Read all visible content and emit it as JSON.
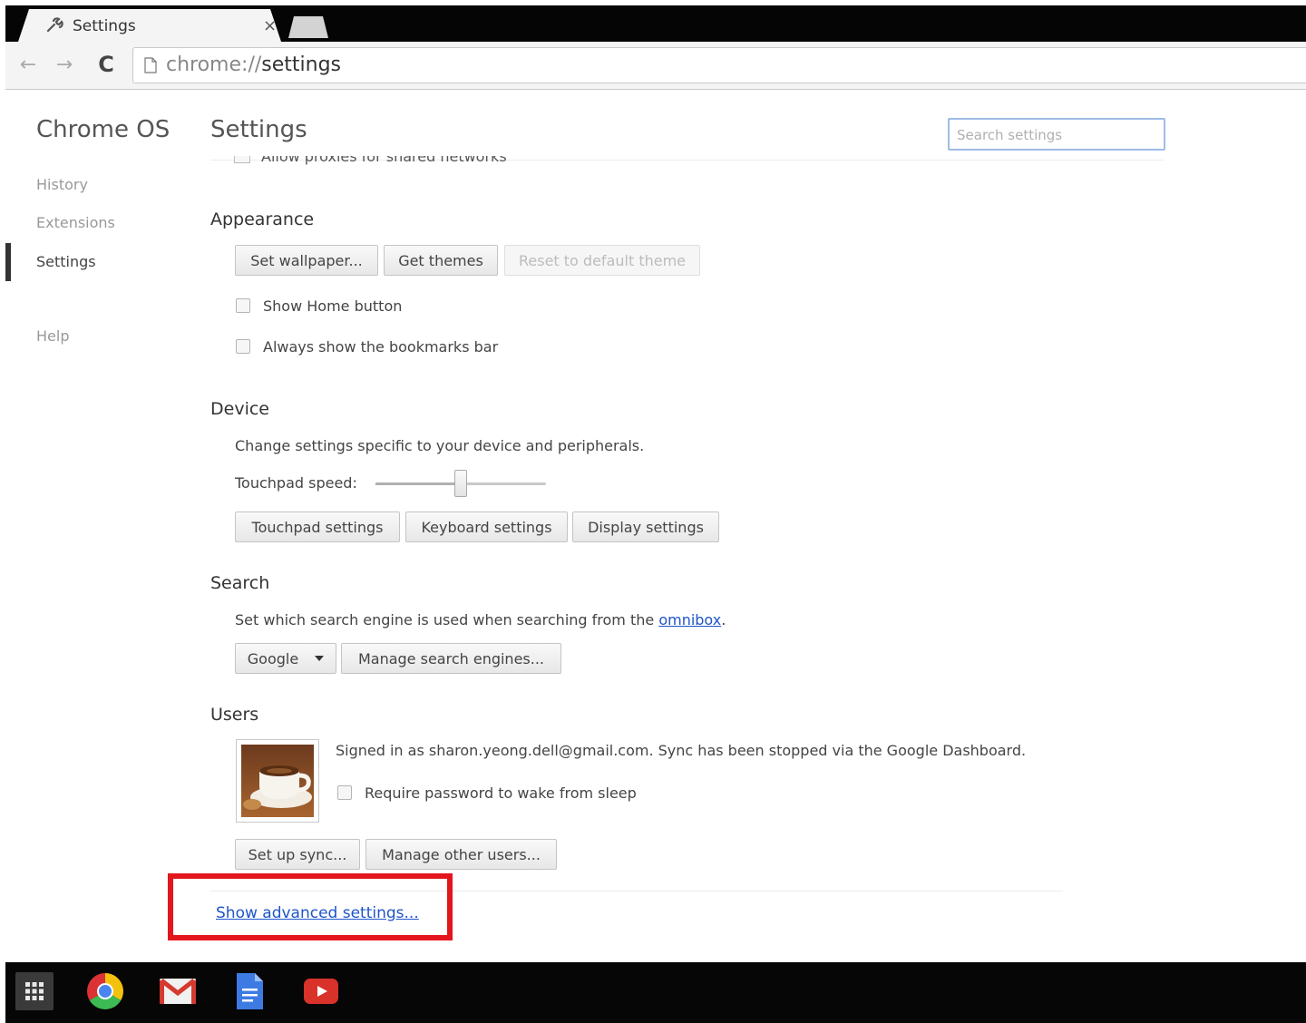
{
  "browser": {
    "tab_title": "Settings",
    "close_glyph": "×",
    "url_scheme": "chrome://",
    "url_host": "settings",
    "back_glyph": "←",
    "forward_glyph": "→",
    "reload_glyph": "C"
  },
  "sidebar": {
    "app_title": "Chrome OS",
    "items": [
      {
        "label": "History"
      },
      {
        "label": "Extensions"
      },
      {
        "label": "Settings",
        "selected": true
      },
      {
        "label": "Help"
      }
    ]
  },
  "header": {
    "title": "Settings",
    "search_placeholder": "Search settings"
  },
  "partial_row_label": "Allow proxies for shared networks",
  "appearance": {
    "title": "Appearance",
    "set_wallpaper": "Set wallpaper...",
    "get_themes": "Get themes",
    "reset_theme": "Reset to default theme",
    "show_home": "Show Home button",
    "show_bookmarks": "Always show the bookmarks bar"
  },
  "device": {
    "title": "Device",
    "description": "Change settings specific to your device and peripherals.",
    "touchpad_speed_label": "Touchpad speed:",
    "touchpad_speed_fraction": 0.5,
    "touchpad_settings": "Touchpad settings",
    "keyboard_settings": "Keyboard settings",
    "display_settings": "Display settings"
  },
  "search": {
    "title": "Search",
    "description_prefix": "Set which search engine is used when searching from the ",
    "omnibox_link": "omnibox",
    "description_suffix": ".",
    "engine": "Google",
    "manage_engines": "Manage search engines..."
  },
  "users": {
    "title": "Users",
    "signed_in": "Signed in as sharon.yeong.dell@gmail.com. Sync has been stopped via the Google Dashboard.",
    "require_password": "Require password to wake from sleep",
    "set_up_sync": "Set up sync...",
    "manage_users": "Manage other users..."
  },
  "advanced_link": "Show advanced settings...",
  "shelf": {
    "items": [
      {
        "icon": "apps-launcher-icon"
      },
      {
        "icon": "chrome-icon"
      },
      {
        "icon": "gmail-icon"
      },
      {
        "icon": "docs-icon"
      },
      {
        "icon": "youtube-icon"
      }
    ]
  },
  "colors": {
    "link": "#1e55c9",
    "highlight": "#e3161e",
    "search_border": "#9fbce6"
  }
}
